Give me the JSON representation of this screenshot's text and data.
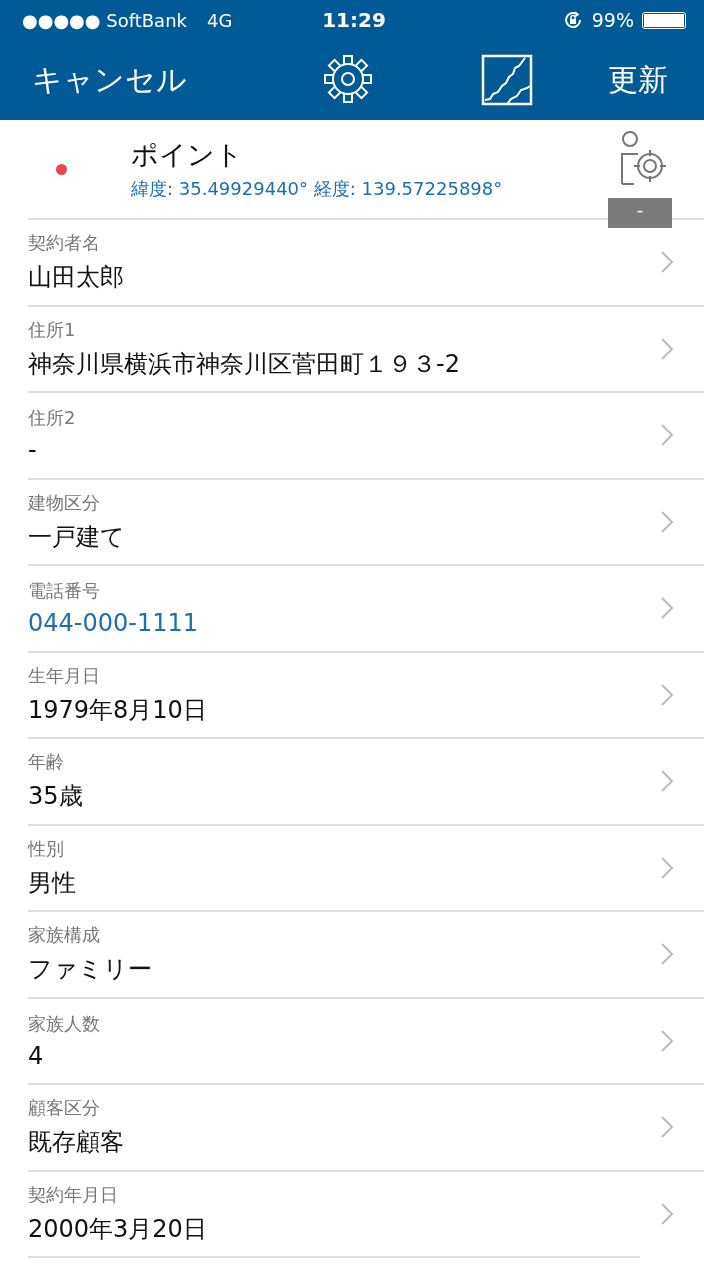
{
  "status_bar": {
    "carrier": "●●●●● SoftBank",
    "network": "4G",
    "time": "11:29",
    "battery": "99%"
  },
  "nav_bar": {
    "cancel": "キャンセル",
    "update": "更新"
  },
  "point": {
    "title": "ポイント",
    "coords": "緯度: 35.49929440° 経度: 139.57225898°",
    "color": "#e8474c",
    "badge": "-"
  },
  "fields": [
    {
      "label": "契約者名",
      "value": "山田太郎",
      "link": false
    },
    {
      "label": "住所1",
      "value": "神奈川県横浜市神奈川区菅田町１９３-2",
      "link": false
    },
    {
      "label": "住所2",
      "value": "-",
      "link": false
    },
    {
      "label": "建物区分",
      "value": "一戸建て",
      "link": false
    },
    {
      "label": "電話番号",
      "value": "044-000-1111",
      "link": true
    },
    {
      "label": "生年月日",
      "value": "1979年8月10日",
      "link": false
    },
    {
      "label": "年齢",
      "value": "35歳",
      "link": false
    },
    {
      "label": "性別",
      "value": "男性",
      "link": false
    },
    {
      "label": "家族構成",
      "value": "ファミリー",
      "link": false
    },
    {
      "label": "家族人数",
      "value": "4",
      "link": false
    },
    {
      "label": "顧客区分",
      "value": "既存顧客",
      "link": false
    },
    {
      "label": "契約年月日",
      "value": "2000年3月20日",
      "link": false
    }
  ]
}
